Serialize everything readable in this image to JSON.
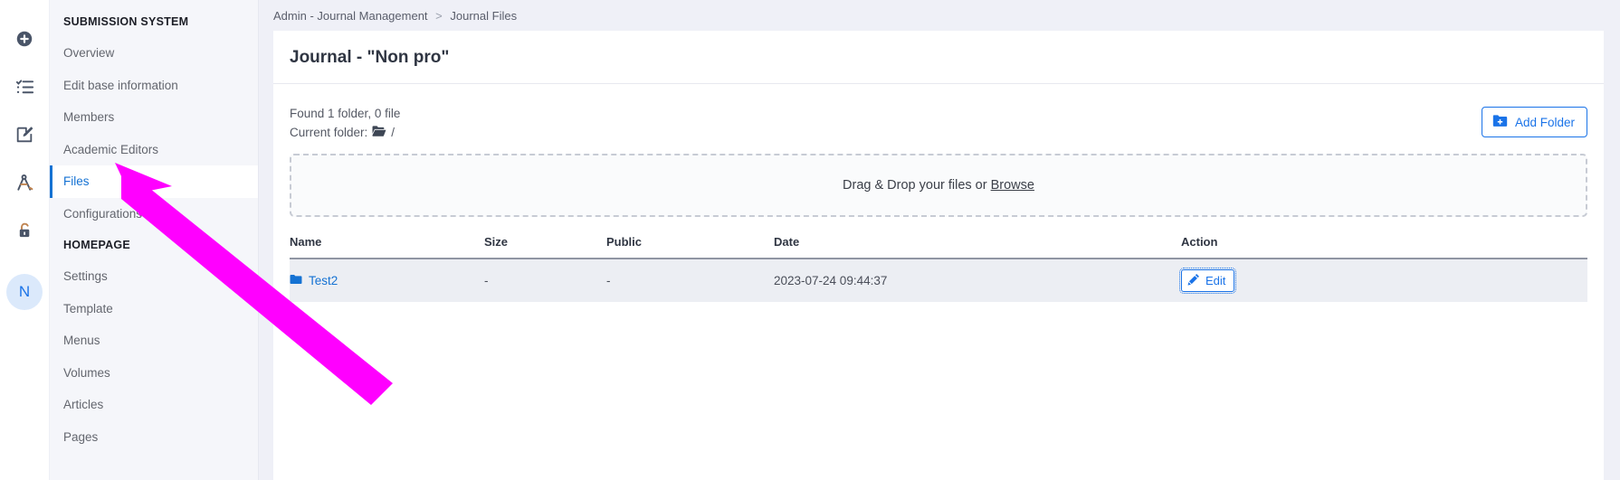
{
  "rail": {
    "icons": [
      {
        "name": "add-circle-icon"
      },
      {
        "name": "checklist-icon"
      },
      {
        "name": "edit-square-icon"
      },
      {
        "name": "compass-icon"
      },
      {
        "name": "unlock-icon"
      }
    ],
    "avatar_initial": "N"
  },
  "sidebar": {
    "sections": [
      {
        "title": "SUBMISSION SYSTEM",
        "items": [
          {
            "label": "Overview",
            "active": false
          },
          {
            "label": "Edit base information",
            "active": false
          },
          {
            "label": "Members",
            "active": false
          },
          {
            "label": "Academic Editors",
            "active": false
          },
          {
            "label": "Files",
            "active": true
          },
          {
            "label": "Configurations",
            "active": false
          }
        ]
      },
      {
        "title": "HOMEPAGE",
        "items": [
          {
            "label": "Settings",
            "active": false
          },
          {
            "label": "Template",
            "active": false
          },
          {
            "label": "Menus",
            "active": false
          },
          {
            "label": "Volumes",
            "active": false
          },
          {
            "label": "Articles",
            "active": false
          },
          {
            "label": "Pages",
            "active": false
          }
        ]
      }
    ]
  },
  "breadcrumb": {
    "root": "Admin - Journal Management",
    "separator": ">",
    "current": "Journal Files"
  },
  "page": {
    "title": "Journal - \"Non pro\""
  },
  "toolbar": {
    "found_text": "Found 1 folder, 0 file",
    "current_folder_label": "Current folder:",
    "current_folder_path": "/",
    "add_folder_label": "Add Folder"
  },
  "dropzone": {
    "text": "Drag & Drop your files or",
    "browse_label": "Browse"
  },
  "table": {
    "headers": [
      "Name",
      "Size",
      "Public",
      "Date",
      "Action"
    ],
    "rows": [
      {
        "name": "Test2",
        "size": "-",
        "public": "-",
        "date": "2023-07-24 09:44:37",
        "action_label": "Edit"
      }
    ]
  },
  "colors": {
    "accent": "#1a73e8",
    "link": "#1572d3",
    "annotation": "#ff00ff",
    "sidebar_bg": "#f5f6fa",
    "main_bg": "#eff0f7"
  }
}
